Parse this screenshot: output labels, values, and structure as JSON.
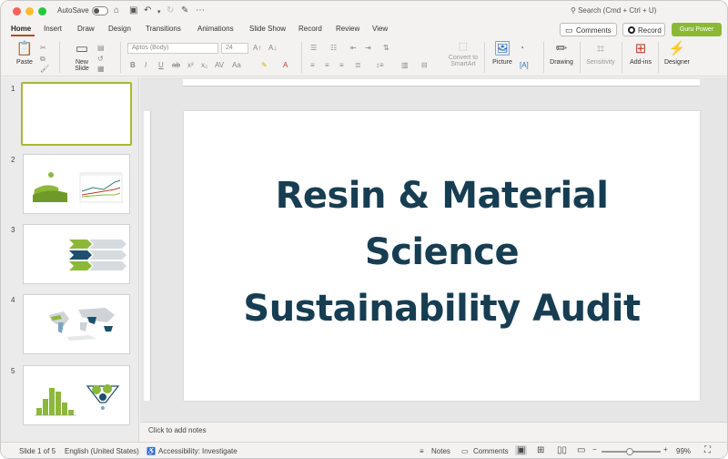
{
  "titlebar": {
    "autosave_label": "AutoSave",
    "search_placeholder": "Search (Cmd + Ctrl + U)"
  },
  "tabs": [
    "Home",
    "Insert",
    "Draw",
    "Design",
    "Transitions",
    "Animations",
    "Slide Show",
    "Record",
    "Review",
    "View"
  ],
  "actions": {
    "comments": "Comments",
    "record": "Record",
    "guru": "Guru Power"
  },
  "ribbon": {
    "paste": "Paste",
    "new_slide_line1": "New",
    "new_slide_line2": "Slide",
    "font_name": "Aptos (Body)",
    "font_size": "24",
    "smartart_line1": "Convert to",
    "smartart_line2": "SmartArt",
    "picture": "Picture",
    "drawing": "Drawing",
    "sensitivity": "Sensitivity",
    "addins": "Add-ins",
    "designer": "Designer"
  },
  "thumbnails": [
    {
      "number": "1"
    },
    {
      "number": "2"
    },
    {
      "number": "3"
    },
    {
      "number": "4"
    },
    {
      "number": "5"
    }
  ],
  "slide": {
    "title_line1": "Resin & Material",
    "title_line2": "Science",
    "title_line3": "Sustainability Audit"
  },
  "notes_placeholder": "Click to add notes",
  "status": {
    "slide_count": "Slide 1 of 5",
    "language": "English (United States)",
    "accessibility": "Accessibility: Investigate",
    "notes": "Notes",
    "comments": "Comments",
    "zoom": "99%"
  },
  "colors": {
    "title": "#173d52",
    "accent_green": "#8cb83a",
    "tab_underline": "#b7472a"
  }
}
